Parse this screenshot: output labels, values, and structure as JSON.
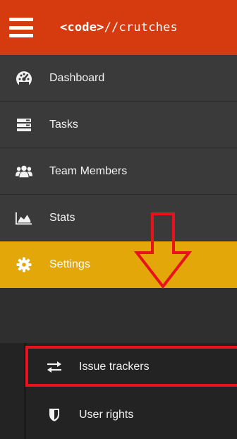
{
  "header": {
    "brand_tag": "<code>",
    "brand_rest": "//crutches",
    "menu_icon": "hamburger-menu-icon"
  },
  "nav": {
    "items": [
      {
        "label": "Dashboard",
        "icon": "tachometer-icon"
      },
      {
        "label": "Tasks",
        "icon": "server-stack-icon"
      },
      {
        "label": "Team Members",
        "icon": "users-icon"
      },
      {
        "label": "Stats",
        "icon": "area-chart-icon"
      },
      {
        "label": "Settings",
        "icon": "gear-icon",
        "active": true
      }
    ]
  },
  "submenu": {
    "items": [
      {
        "label": "Issue trackers",
        "icon": "exchange-arrows-icon"
      },
      {
        "label": "User rights",
        "icon": "shield-icon"
      }
    ]
  },
  "colors": {
    "header_bg": "#d63b0f",
    "sidebar_bg": "#3a3a3a",
    "submenu_bg": "#232323",
    "active_bg": "#e3a70a",
    "annotation_red": "#e8121d"
  }
}
